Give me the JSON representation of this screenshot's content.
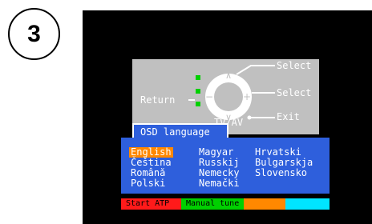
{
  "step_number": "3",
  "remote": {
    "labels": {
      "select_top": "Select",
      "select_middle": "Select",
      "exit": "Exit",
      "return": "Return",
      "tv_av": "TV/AV"
    },
    "colors": {
      "panel": "#c0c0c0",
      "indicator": "#00d000"
    }
  },
  "menu": {
    "title": "OSD language",
    "selected": "English",
    "languages": [
      [
        "English",
        "Čeština",
        "Română",
        "Polski"
      ],
      [
        "Magyar",
        "Russkij",
        "Nemecky",
        "Nemački"
      ],
      [
        "Hrvatski",
        "Bulgarskja",
        "Slovensko"
      ]
    ],
    "colors": {
      "background": "#2e5fdc",
      "highlight": "#ff8800"
    }
  },
  "color_bar": [
    {
      "label": "Start ATP",
      "color": "#ff1a1a",
      "text_color": "#000000"
    },
    {
      "label": "Manual tune",
      "color": "#00d000",
      "text_color": "#000000"
    },
    {
      "label": "",
      "color": "#ff8800",
      "text_color": "#000000"
    },
    {
      "label": "",
      "color": "#00e5ff",
      "text_color": "#000000"
    }
  ]
}
